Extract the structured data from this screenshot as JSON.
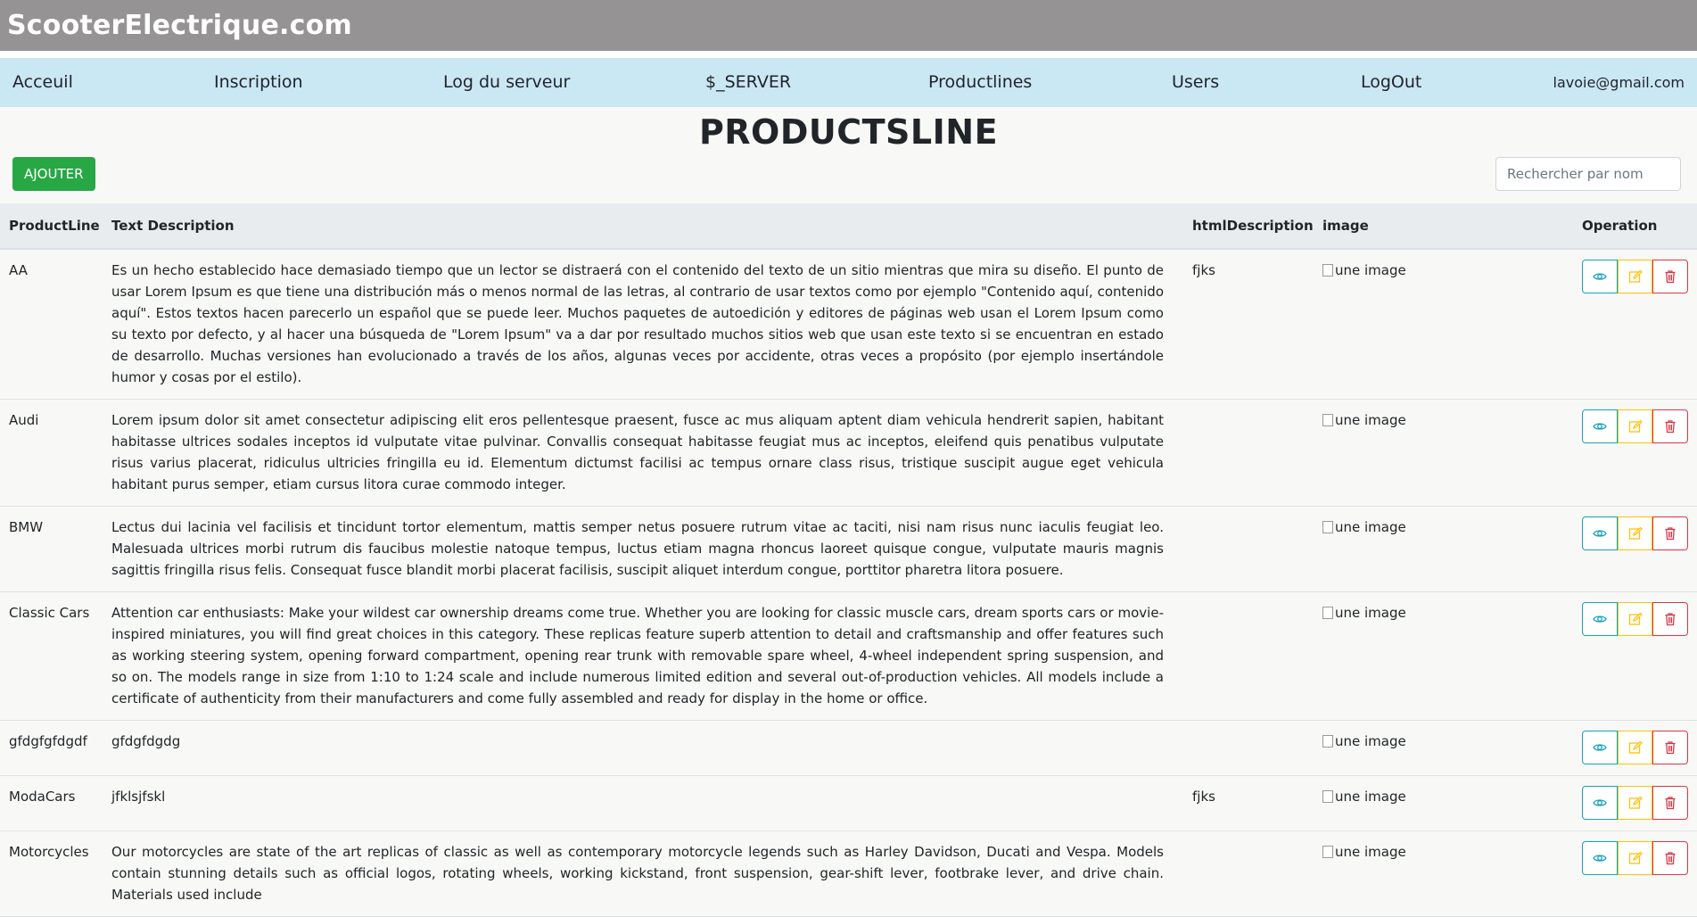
{
  "site": {
    "brand": "ScooterElectrique.com"
  },
  "nav": {
    "items": [
      "Acceuil",
      "Inscription",
      "Log du serveur",
      "$_SERVER",
      "Productlines",
      "Users",
      "LogOut"
    ],
    "email": "lavoie@gmail.com"
  },
  "page": {
    "title": "PRODUCTSLINE"
  },
  "toolbar": {
    "add_label": "AJOUTER",
    "search_placeholder": "Rechercher par nom"
  },
  "table": {
    "headers": [
      "ProductLine",
      "Text Description",
      "htmlDescription",
      "image",
      "Operation"
    ],
    "image_alt": "une image",
    "rows": [
      {
        "productline": "AA",
        "description": "Es un hecho establecido hace demasiado tiempo que un lector se distraerá con el contenido del texto de un sitio mientras que mira su diseño. El punto de usar Lorem Ipsum es que tiene una distribución más o menos normal de las letras, al contrario de usar textos como por ejemplo \"Contenido aquí, contenido aquí\". Estos textos hacen parecerlo un español que se puede leer. Muchos paquetes de autoedición y editores de páginas web usan el Lorem Ipsum como su texto por defecto, y al hacer una búsqueda de \"Lorem Ipsum\" va a dar por resultado muchos sitios web que usan este texto si se encuentran en estado de desarrollo. Muchas versiones han evolucionado a través de los años, algunas veces por accidente, otras veces a propósito (por ejemplo insertándole humor y cosas por el estilo).",
        "html": "fjks"
      },
      {
        "productline": "Audi",
        "description": "Lorem ipsum dolor sit amet consectetur adipiscing elit eros pellentesque praesent, fusce ac mus aliquam aptent diam vehicula hendrerit sapien, habitant habitasse ultrices sodales inceptos id vulputate vitae pulvinar. Convallis consequat habitasse feugiat mus ac inceptos, eleifend quis penatibus vulputate risus varius placerat, ridiculus ultricies fringilla eu id. Elementum dictumst facilisi ac tempus ornare class risus, tristique suscipit augue eget vehicula habitant purus semper, etiam cursus litora curae commodo integer.",
        "html": ""
      },
      {
        "productline": "BMW",
        "description": "Lectus dui lacinia vel facilisis et tincidunt tortor elementum, mattis semper netus posuere rutrum vitae ac taciti, nisi nam risus nunc iaculis feugiat leo. Malesuada ultrices morbi rutrum dis faucibus molestie natoque tempus, luctus etiam magna rhoncus laoreet quisque congue, vulputate mauris magnis sagittis fringilla risus felis. Consequat fusce blandit morbi placerat facilisis, suscipit aliquet interdum congue, porttitor pharetra litora posuere.",
        "html": ""
      },
      {
        "productline": "Classic Cars",
        "description": "Attention car enthusiasts: Make your wildest car ownership dreams come true. Whether you are looking for classic muscle cars, dream sports cars or movie-inspired miniatures, you will find great choices in this category. These replicas feature superb attention to detail and craftsmanship and offer features such as working steering system, opening forward compartment, opening rear trunk with removable spare wheel, 4-wheel independent spring suspension, and so on. The models range in size from 1:10 to 1:24 scale and include numerous limited edition and several out-of-production vehicles. All models include a certificate of authenticity from their manufacturers and come fully assembled and ready for display in the home or office.",
        "html": ""
      },
      {
        "productline": "gfdgfgfdgdf",
        "description": "gfdgfdgdg",
        "html": ""
      },
      {
        "productline": "ModaCars",
        "description": "jfklsjfskl",
        "html": "fjks"
      },
      {
        "productline": "Motorcycles",
        "description": "Our motorcycles are state of the art replicas of classic as well as contemporary motorcycle legends such as Harley Davidson, Ducati and Vespa. Models contain stunning details such as official logos, rotating wheels, working kickstand, front suspension, gear-shift lever, footbrake lever, and drive chain. Materials used include",
        "html": ""
      }
    ]
  },
  "icons": {
    "view": "eye-icon",
    "edit": "pencil-square-icon",
    "delete": "trash-icon"
  },
  "colors": {
    "add": "#28a745",
    "view": "#17a2b8",
    "edit": "#ffc107",
    "delete": "#dc3545",
    "navbar": "#cae7f4",
    "topbar": "#959394"
  }
}
